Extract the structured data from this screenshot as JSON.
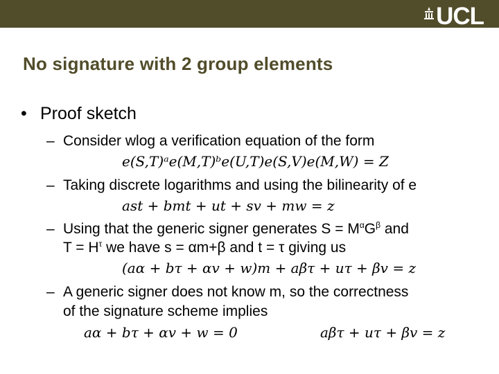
{
  "header": {
    "logo_text": "UCL",
    "bar_color": "#514c2a"
  },
  "slide": {
    "title": "No signature with 2 group elements",
    "bullet": {
      "symbol": "•",
      "label": "Proof sketch"
    },
    "items": [
      {
        "dash": "–",
        "text": "Consider wlog a verification equation of the form",
        "equation": "e(S,T)ᵃe(M,T)ᵇe(U,T)e(S,V)e(M,W) = Z"
      },
      {
        "dash": "–",
        "text": "Taking discrete logarithms and using the bilinearity of e",
        "equation": "ast + bmt + ut + sv + mw = z"
      },
      {
        "dash": "–",
        "text_line1_a": "Using that the generic signer generates  S = M",
        "text_line1_sup1": "α",
        "text_line1_b": "G",
        "text_line1_sup2": "β",
        "text_line1_c": " and",
        "text_line2_a": "T = H",
        "text_line2_sup": "τ",
        "text_line2_b": " we have s = αm+β and t = τ giving us",
        "equation": "(aα + bτ + αv + w)m + aβτ + uτ + βv = z"
      },
      {
        "dash": "–",
        "text_line1": "A generic signer does not know m, so the correctness",
        "text_line2": "of the signature scheme implies",
        "equation_left": "aα + bτ + αv + w = 0",
        "equation_right": "aβτ + uτ + βv = z"
      }
    ]
  }
}
